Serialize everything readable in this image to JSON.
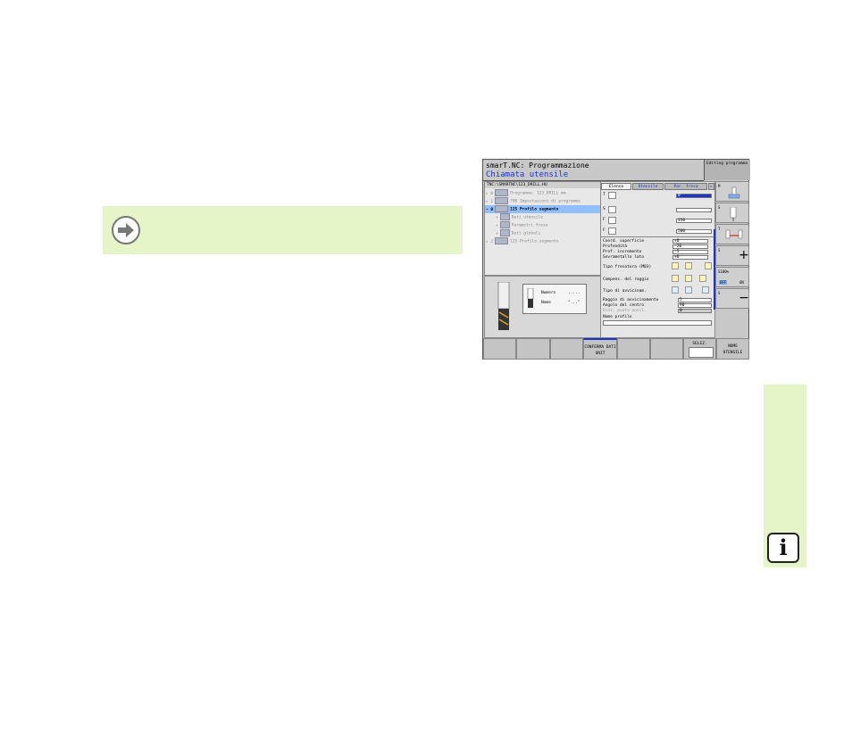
{
  "app": {
    "title": "smarT.NC: Programmazione",
    "subtitle": "Chiamata utensile",
    "mode_label": "Editing programma"
  },
  "tree": {
    "path": "TNC:\\SMARTNC\\123_DRILL.HU",
    "items": [
      {
        "prefix": "▸ 0",
        "label": "Programma: 123_DRILL mm",
        "selected": false
      },
      {
        "prefix": "▸ 1",
        "label": "700 Impostazioni di programma",
        "selected": false
      },
      {
        "prefix": "− 0",
        "label": "125 Profilo segmento",
        "selected": true
      },
      {
        "prefix": "+",
        "label": "Dati utensile",
        "selected": false
      },
      {
        "prefix": "+",
        "label": "Parametri fresa",
        "selected": false
      },
      {
        "prefix": "+",
        "label": "Dati globali",
        "selected": false
      },
      {
        "prefix": "▸ 2",
        "label": "125 Profilo segmento",
        "selected": false
      }
    ]
  },
  "preview": {
    "rows": [
      {
        "label": "Numero",
        "value": "....."
      },
      {
        "label": "Nome",
        "value": "\"...\""
      }
    ]
  },
  "form": {
    "tabs": [
      "Elenco",
      "Utensile",
      "Par. fresa"
    ],
    "tab_more": "▸",
    "fields": [
      {
        "icon": "T",
        "value": "0"
      },
      {
        "icon": "S",
        "value": ""
      },
      {
        "icon": "F",
        "value": "150"
      },
      {
        "icon": "F",
        "value": "500"
      }
    ],
    "params": [
      {
        "label": "Coord. superficie",
        "value": "+0"
      },
      {
        "label": "Profondità",
        "value": "-20"
      },
      {
        "label": "Prof. incremento",
        "value": "-5"
      },
      {
        "label": "Sovrametallo lato",
        "value": "+0"
      }
    ],
    "tipo_fresatura": "Tipo fresatura (M03)",
    "compens_raggio": "Compens. del raggio",
    "tipo_avvicinam": "Tipo di avvicinam.",
    "params2": [
      {
        "label": "Raggio di avvicinamento",
        "value": "5"
      },
      {
        "label": "Angolo del centro",
        "value": "90"
      },
      {
        "label": "Dist. punto ausil.",
        "value": "0"
      }
    ],
    "nome_profilo": "Nome profilo"
  },
  "side_softkeys": [
    {
      "label": "M"
    },
    {
      "label": "S"
    },
    {
      "label": "T"
    },
    {
      "label": "S"
    },
    {
      "label": "S100%",
      "off": "OFF",
      "on": "ON"
    },
    {
      "label": "S"
    }
  ],
  "softkeys": [
    {
      "label": ""
    },
    {
      "label": ""
    },
    {
      "label": ""
    },
    {
      "label": "CONFERMA DATI UNIT"
    },
    {
      "label": ""
    },
    {
      "label": ""
    },
    {
      "label": "SELEZ."
    },
    {
      "label": "NOME UTENSILE"
    }
  ],
  "colors": {
    "note_bg": "#e5f5c8",
    "title_blue": "#1b35c9",
    "selection": "#8fbfff"
  },
  "icons": {
    "note": "arrow-right-circle-icon",
    "info": "info-icon"
  },
  "info_glyph": "i"
}
